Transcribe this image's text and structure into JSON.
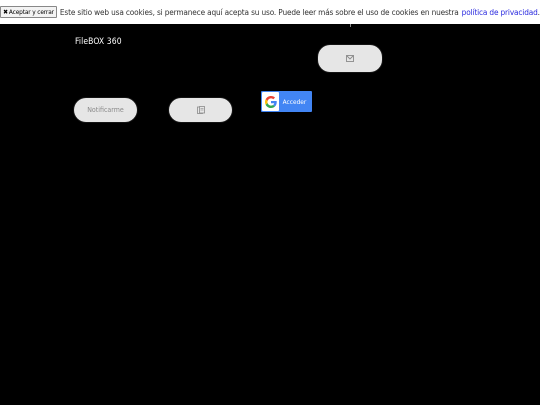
{
  "cookie_banner": {
    "accept_label": "Aceptar y cerrar",
    "message": "Este sitio web usa cookies, si permanece aquí acepta su uso. Puede leer más sobre el uso de cookies en nuestra",
    "privacy_link": "política de privacidad",
    "trailing": "."
  },
  "brand": {
    "name": "FileBOX 360"
  },
  "actions": {
    "notify_label": "Notificarme"
  },
  "google": {
    "sign_in_label": "Acceder"
  },
  "colors": {
    "background": "#000000",
    "pill": "#e6e6e6",
    "google_blue": "#4285f4",
    "link": "#2a2adf"
  },
  "icons": {
    "top_pill": "email-icon",
    "contact_pill": "contact-card-icon",
    "google": "google-logo-icon",
    "close": "close-icon"
  }
}
